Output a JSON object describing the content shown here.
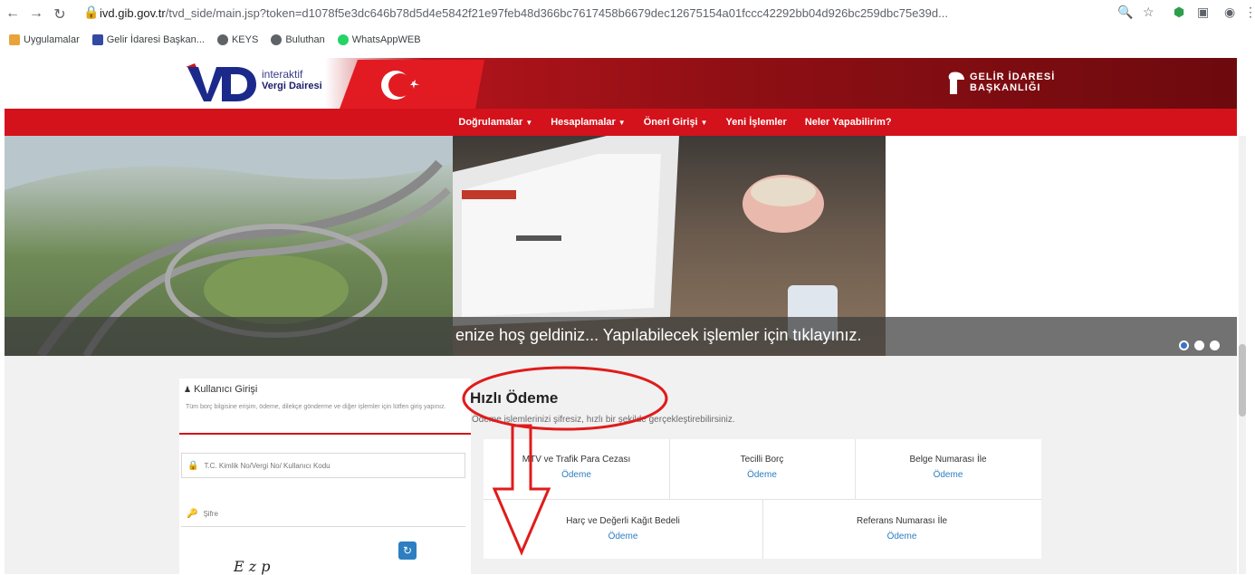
{
  "browser": {
    "url_host": "ivd.gib.gov.tr",
    "url_rest": "/tvd_side/main.jsp?token=d1078f5e3dc646b78d5d4e5842f21e97feb48d366bc7617458b6679dec12675154a01fccc42292bb04d926bc259dbc75e39d...",
    "bookmarks": [
      "Uygulamalar",
      "Gelir İdaresi Başkan...",
      "KEYS",
      "Buluthan",
      "WhatsAppWEB"
    ]
  },
  "header": {
    "logo_line1": "interaktif",
    "logo_line2": "Vergi Dairesi",
    "gib_line1": "GELİR İDARESİ",
    "gib_line2": "BAŞKANLIĞI"
  },
  "nav": {
    "items": [
      {
        "label": "Doğrulamalar",
        "dropdown": true
      },
      {
        "label": "Hesaplamalar",
        "dropdown": true
      },
      {
        "label": "Öneri Girişi",
        "dropdown": true
      },
      {
        "label": "Yeni İşlemler",
        "dropdown": false
      },
      {
        "label": "Neler Yapabilirim?",
        "dropdown": false
      }
    ]
  },
  "hero": {
    "caption": "enize hoş geldiniz... Yapılabilecek işlemler için tıklayınız.",
    "active_slide": 1
  },
  "login": {
    "title": "Kullanıcı Girişi",
    "description": "Tüm borç bilgisine erişim, ödeme, dilekçe gönderme ve diğer işlemler için lütfen giriş yapınız.",
    "user_placeholder": "T.C. Kimlik No/Vergi No/ Kullanıcı Kodu",
    "password_placeholder": "Şifre",
    "captcha_partial": "E    z p"
  },
  "quick_payment": {
    "title": "Hızlı Ödeme",
    "description": "Ödeme işlemlerinizi şifresiz, hızlı bir şekilde gerçekleştirebilirsiniz.",
    "row1": [
      {
        "label": "MTV ve Trafik Para Cezası",
        "action": "Ödeme"
      },
      {
        "label": "Tecilli Borç",
        "action": "Ödeme"
      },
      {
        "label": "Belge Numarası İle",
        "action": "Ödeme"
      }
    ],
    "row2": [
      {
        "label": "Harç ve Değerli Kağıt Bedeli",
        "action": "Ödeme"
      },
      {
        "label": "Referans Numarası İle",
        "action": "Ödeme"
      }
    ]
  },
  "colors": {
    "brand_red": "#d4121b",
    "link_blue": "#2d7fc1",
    "annotation_red": "#e01b1b"
  }
}
